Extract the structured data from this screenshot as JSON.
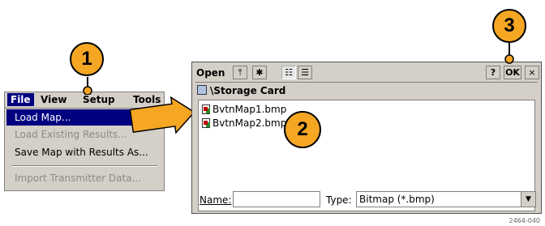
{
  "menu": {
    "bar": [
      "File",
      "View",
      "Setup",
      "Tools"
    ],
    "items": [
      {
        "label": "Load Map...",
        "state": "selected"
      },
      {
        "label": "Load Existing Results...",
        "state": "disabled"
      },
      {
        "label": "Save Map with Results As...",
        "state": "normal"
      },
      {
        "label": "Import Transmitter Data...",
        "state": "disabled"
      }
    ]
  },
  "callouts": [
    "1",
    "2",
    "3"
  ],
  "dialog": {
    "title": "Open",
    "path": "\\Storage Card",
    "files": [
      "BvtnMap1.bmp",
      "BvtnMap2.bmp"
    ],
    "help_label": "?",
    "ok_label": "OK",
    "close_label": "×",
    "name_label": "Name:",
    "name_value": "",
    "type_label": "Type:",
    "type_value": "Bitmap (*.bmp)"
  },
  "figure_code": "2464-040",
  "colors": {
    "callout": "#f5a623",
    "selection": "#000080",
    "chrome": "#d4d0c8"
  }
}
